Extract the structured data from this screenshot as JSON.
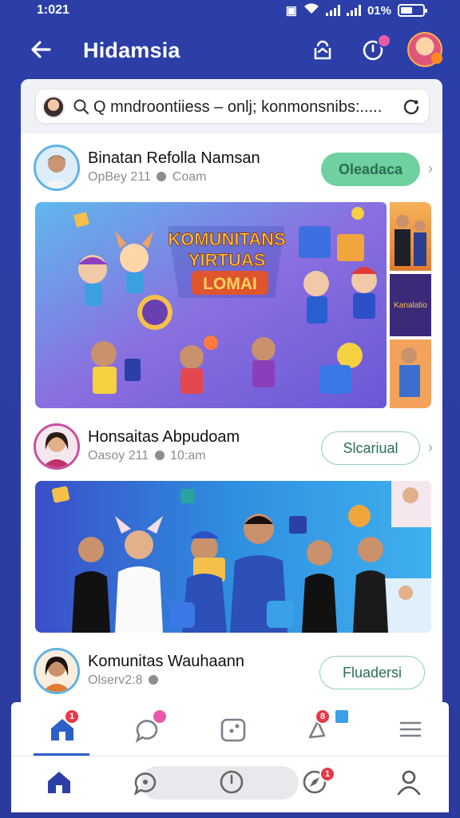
{
  "status_bar": {
    "time": "1:021",
    "battery": "01%"
  },
  "header": {
    "title": "Hidamsia"
  },
  "search": {
    "placeholder": "Q mndroontiiess – onlj; konmonsnibs:....."
  },
  "posts": [
    {
      "name": "Binatan Refolla Namsan",
      "meta": "OpBey 211",
      "time": "Coam",
      "button": "Oleadaca",
      "image": {
        "headline_1": "KOMUNITANS",
        "headline_2": "YIRTUAS",
        "headline_3": "LOMAI",
        "side_label": "Kanalatio"
      }
    },
    {
      "name": "Honsaitas Abpudoam",
      "meta": "Oasoy 211",
      "time": "10:am",
      "button": "Slcariual"
    },
    {
      "name": "Komunitas Wauhaann",
      "meta": "Olserv2:8",
      "time": "",
      "button": "Fluadersi"
    }
  ],
  "tabbar": {
    "home_badge": "1",
    "alerts_badge": "8",
    "nav_badge": "1"
  },
  "colors": {
    "brand": "#2c3fa8",
    "accent_green": "#6fd0a0",
    "badge_red": "#e63946",
    "tab_active": "#2c5fc7"
  }
}
